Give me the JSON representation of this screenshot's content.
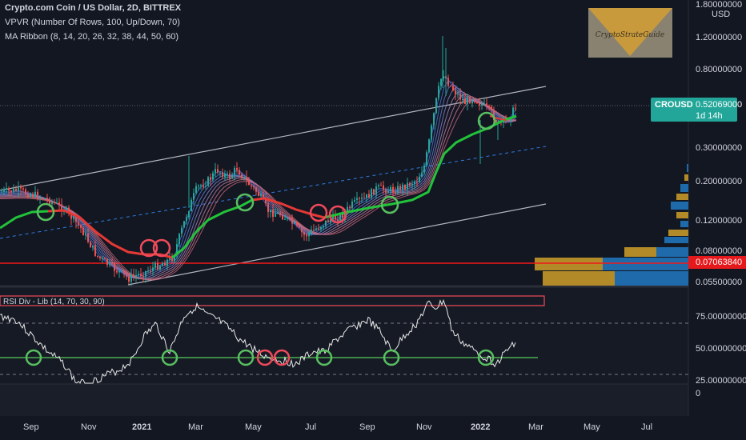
{
  "header": {
    "symbol_line": "Crypto.com Coin / US Dollar, 2D, BITTREX",
    "indicator_1": "VPVR (Number Of Rows, 100, Up/Down, 70)",
    "indicator_2": "MA Ribbon (8, 14, 20, 26, 32, 38, 44, 50, 60)"
  },
  "price_axis": {
    "currency": "USD",
    "ticks": [
      "1.80000000",
      "1.20000000",
      "0.80000000",
      "0.30000000",
      "0.20000000",
      "0.12000000",
      "0.08000000",
      "0.05500000"
    ]
  },
  "price_labels": {
    "symbol": "CROUSD",
    "last_price": "0.52069000",
    "countdown": "1d 14h",
    "red_line_price": "0.07063840"
  },
  "rsi": {
    "title": "RSI Div - Lib (14, 70, 30, 90)",
    "ticks": [
      "75.00000000",
      "50.00000000",
      "25.00000000",
      "0"
    ]
  },
  "time_axis": {
    "labels": [
      "Sep",
      "Nov",
      "2021",
      "Mar",
      "May",
      "Jul",
      "Sep",
      "Nov",
      "2022",
      "Mar",
      "May",
      "Jul"
    ]
  },
  "logo": {
    "text": "CryptoStrateGuide"
  },
  "colors": {
    "background": "#131722",
    "candle_up": "#26a69a",
    "candle_down": "#ef5350",
    "ma_slow_green": "#22c33a",
    "ma_red": "#e53935",
    "channel_line": "#b2b5be",
    "mid_dash": "#2f7de1",
    "support_line": "#f21818",
    "circle_green": "#58c060",
    "circle_red": "#f04a5a",
    "rsi_line": "#e8e8e8",
    "price_tag": "#22a699",
    "vp_yellow": "#b38a28",
    "vp_blue": "#1e6aab"
  }
}
